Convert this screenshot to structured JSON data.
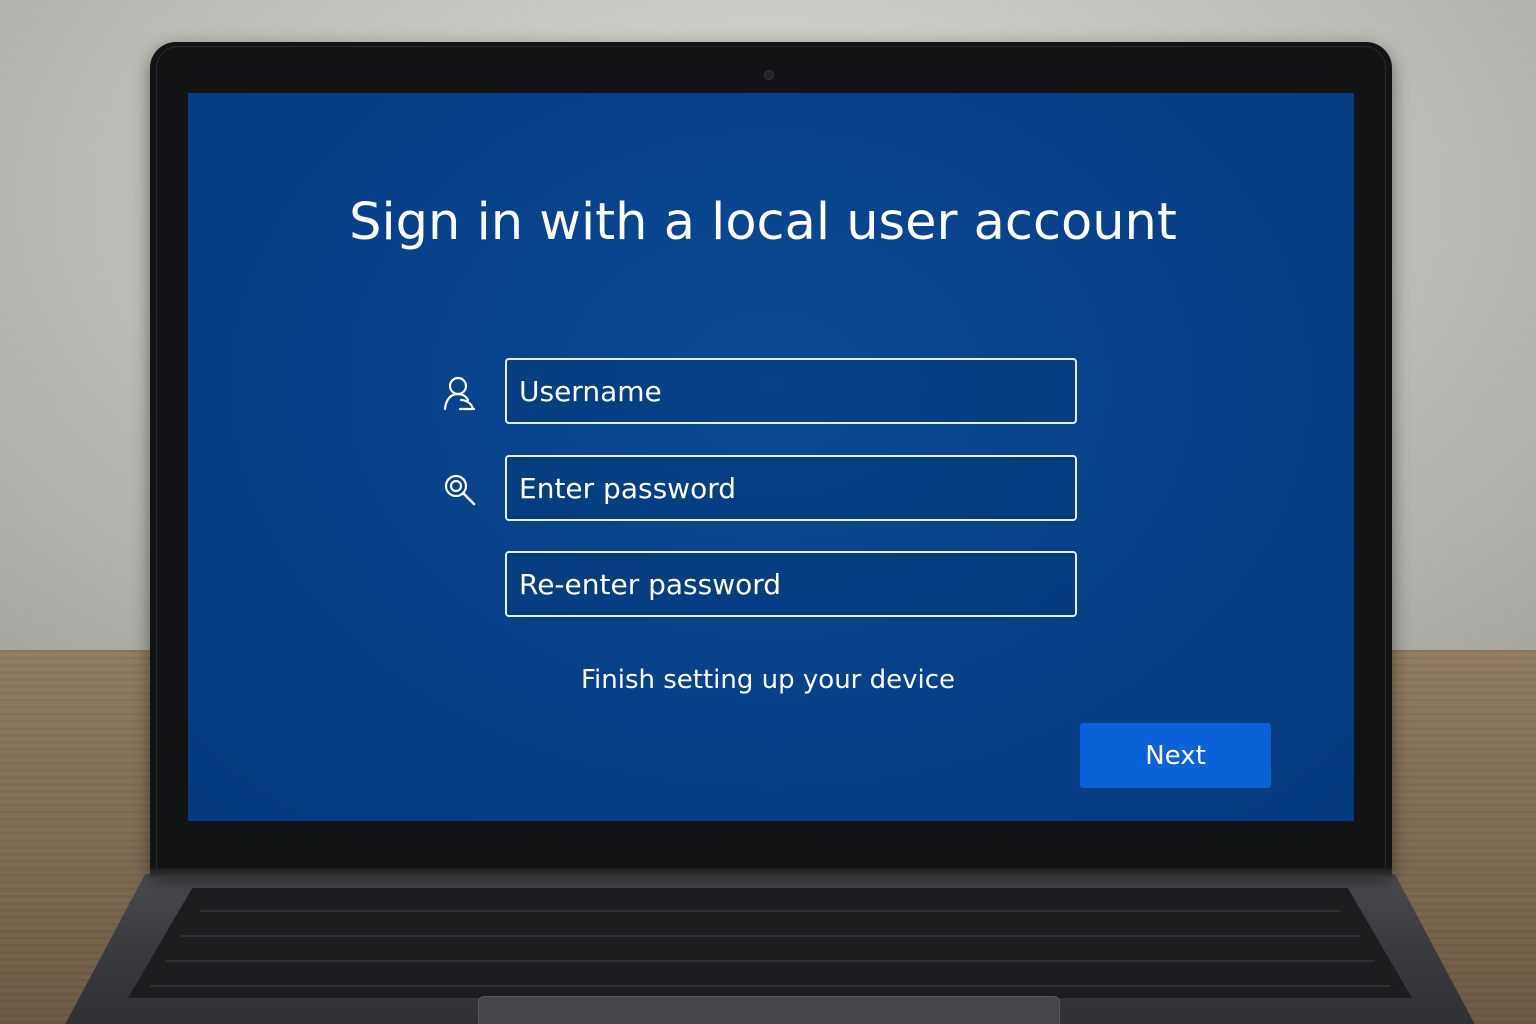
{
  "screen": {
    "title": "Sign in with a local user account",
    "username": {
      "placeholder": "Username",
      "value": ""
    },
    "password": {
      "placeholder": "Enter password",
      "value": ""
    },
    "confirm_password": {
      "placeholder": "Re-enter password",
      "value": ""
    },
    "subtitle": "Finish setting up your device",
    "next_label": "Next"
  },
  "icons": {
    "user": "user-icon",
    "key": "key-icon"
  },
  "colors": {
    "screen_background": "#074088",
    "button": "#0b62d6",
    "text": "#ffffff"
  }
}
